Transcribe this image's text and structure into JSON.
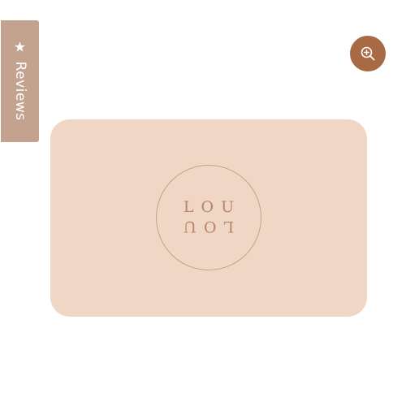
{
  "reviews_tab": {
    "label": "Reviews",
    "icon": "star-icon",
    "color": "#c4a290"
  },
  "zoom_button": {
    "icon": "zoom-in-icon",
    "color": "#a86a45"
  },
  "product": {
    "image_color": "#f0d6c4",
    "logo_top": "LOU",
    "logo_bottom": "LOU"
  }
}
